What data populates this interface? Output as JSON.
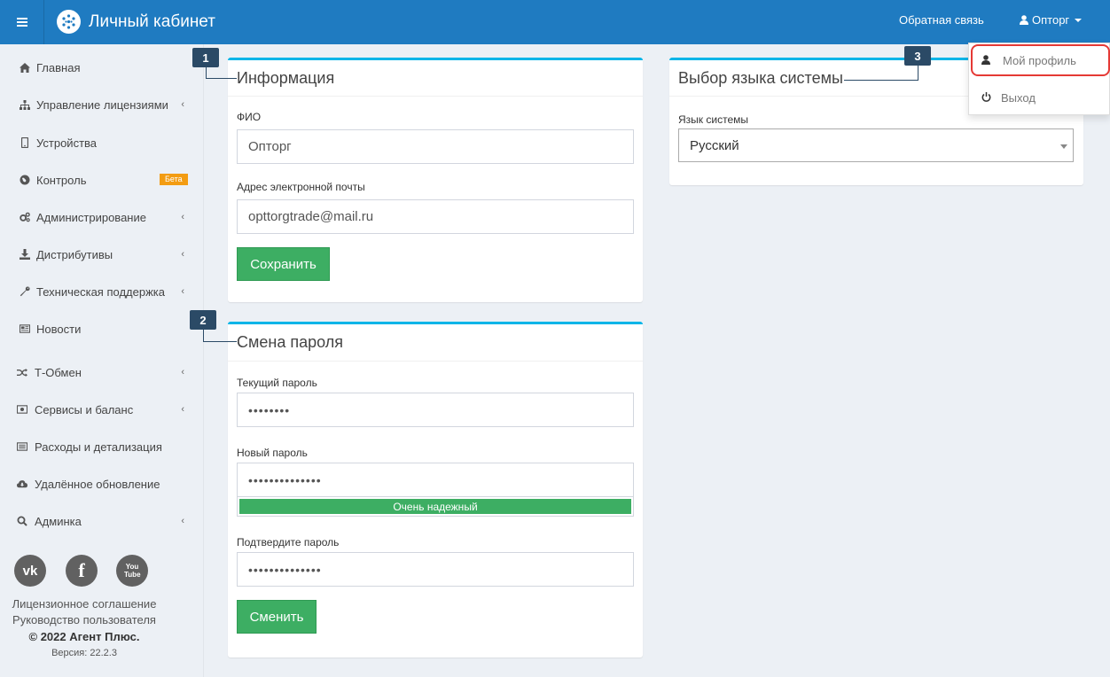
{
  "header": {
    "title": "Личный кабинет",
    "feedback": "Обратная связь",
    "user": "Опторг"
  },
  "sidebar": {
    "items": [
      {
        "label": "Главная",
        "icon": "home-icon"
      },
      {
        "label": "Управление лицензиями",
        "icon": "sitemap-icon",
        "chevron": "‹"
      },
      {
        "label": "Устройства",
        "icon": "mobile-icon"
      },
      {
        "label": "Контроль",
        "icon": "globe-icon",
        "badge": "Бета"
      },
      {
        "label": "Администрирование",
        "icon": "cogs-icon",
        "chevron": "‹"
      },
      {
        "label": "Дистрибутивы",
        "icon": "download-icon",
        "chevron": "‹"
      },
      {
        "label": "Техническая поддержка",
        "icon": "wrench-icon",
        "chevron": "‹"
      },
      {
        "label": "Новости",
        "icon": "newspaper-icon"
      },
      {
        "label": "Т-Обмен",
        "icon": "shuffle-icon",
        "chevron": "‹"
      },
      {
        "label": "Сервисы и баланс",
        "icon": "money-icon",
        "chevron": "‹"
      },
      {
        "label": "Расходы и детализация",
        "icon": "list-icon"
      },
      {
        "label": "Удалённое обновление",
        "icon": "cloud-download-icon"
      },
      {
        "label": "Админка",
        "icon": "search-icon",
        "chevron": "‹"
      }
    ],
    "social": {
      "vk": "vk",
      "facebook": "f",
      "youtube": "You Tube"
    },
    "footer": {
      "license": "Лицензионное соглашение",
      "manual": "Руководство пользователя",
      "copyright": "© 2022 Агент Плюс.",
      "version": "Версия: 22.2.3"
    }
  },
  "info": {
    "title": "Информация",
    "fio_label": "ФИО",
    "fio_value": "Опторг",
    "email_label": "Адрес электронной почты",
    "email_value": "opttorgtrade@mail.ru",
    "save_label": "Сохранить"
  },
  "password": {
    "title": "Смена пароля",
    "current_label": "Текущий пароль",
    "current_value": "••••••••",
    "new_label": "Новый пароль",
    "new_value": "••••••••••••••",
    "strength": "Очень надежный",
    "confirm_label": "Подтвердите пароль",
    "confirm_value": "••••••••••••••",
    "change_label": "Сменить"
  },
  "language": {
    "title": "Выбор языка системы",
    "label": "Язык системы",
    "value": "Русский"
  },
  "dropdown": {
    "profile": "Мой профиль",
    "logout": "Выход"
  },
  "callouts": [
    "1",
    "2",
    "3"
  ],
  "colors": {
    "header": "#1f7bc1",
    "accent": "#00b5e8",
    "success": "#3dae63",
    "badge": "#f39c12",
    "callout": "#2b4a66",
    "highlight": "#e53935"
  }
}
